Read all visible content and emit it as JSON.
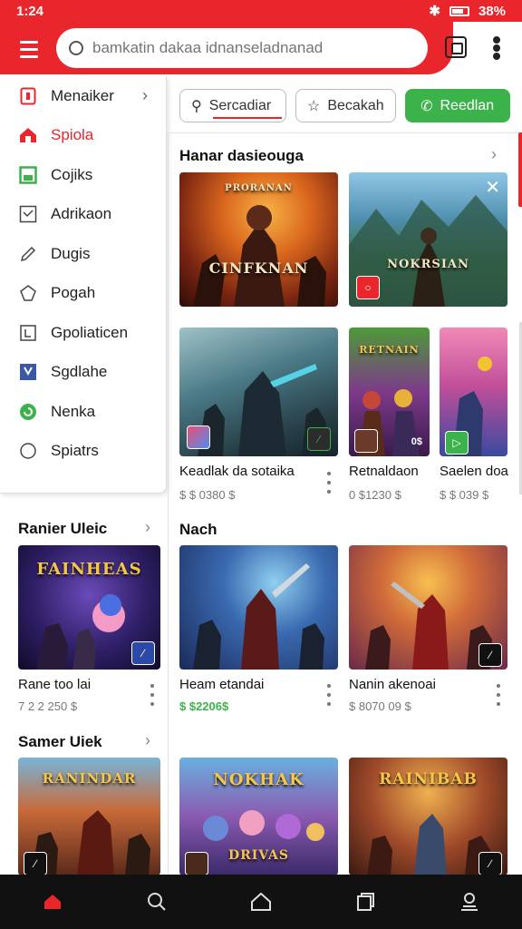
{
  "status": {
    "time": "1:24",
    "battery": "38%"
  },
  "search": {
    "placeholder": "bamkatin dakaa idnanseladnanad"
  },
  "drawer": {
    "items": [
      {
        "label": "Menaiker",
        "icon": "tablet-icon"
      },
      {
        "label": "Spiola",
        "icon": "home-icon"
      },
      {
        "label": "Cojiks",
        "icon": "window-icon"
      },
      {
        "label": "Adrikaon",
        "icon": "checkbox-icon"
      },
      {
        "label": "Dugis",
        "icon": "pen-icon"
      },
      {
        "label": "Pogah",
        "icon": "tag-icon"
      },
      {
        "label": "Gpoliaticen",
        "icon": "page-icon"
      },
      {
        "label": "Sgdlahe",
        "icon": "bookmark-icon"
      },
      {
        "label": "Nenka",
        "icon": "refresh-icon"
      },
      {
        "label": "Spiatrs",
        "icon": "circle-icon"
      }
    ]
  },
  "filters": {
    "search": "Sercadiar",
    "second": "Becakah",
    "third": "Reedlan"
  },
  "sections": {
    "top_title": "Hanar dasieouga",
    "left1_title": "Ranier Uleic",
    "left2_title": "Samer Uiek",
    "mid_title": "Nach"
  },
  "cards": {
    "top1": {
      "art_text": "CINFKNAN",
      "banner": "PRORANAN"
    },
    "top2": {
      "art_text": "NOKRSIAN"
    },
    "row2_1": {
      "title": "Keadlak da sotaika",
      "price": "$ $ 0380 $"
    },
    "row2_2": {
      "title": "Retnaldaon",
      "price": "0 $1230 $",
      "art_text": "RETNAIN"
    },
    "row2_3": {
      "title": "Saelen doa",
      "price": "$ $ 039 $"
    },
    "left1": {
      "title": "Rane too lai",
      "price": "7 2 2 250 $",
      "art_text": "FAINHEAS"
    },
    "mid1": {
      "title": "Heam etandai",
      "price": "$ $2206$"
    },
    "mid2": {
      "title": "Nanin akenoai",
      "price": "$ 8070 09 $"
    },
    "left2": {
      "art_text": "RANINDAR"
    },
    "bot_mid": {
      "art_text": "NOKHAK",
      "art_sub": "DRIVAS"
    },
    "bot_right": {
      "art_text": "RAINIBAB"
    }
  },
  "colors": {
    "accent": "#e8262b",
    "green": "#3cb34a",
    "navbar": "#111111"
  }
}
